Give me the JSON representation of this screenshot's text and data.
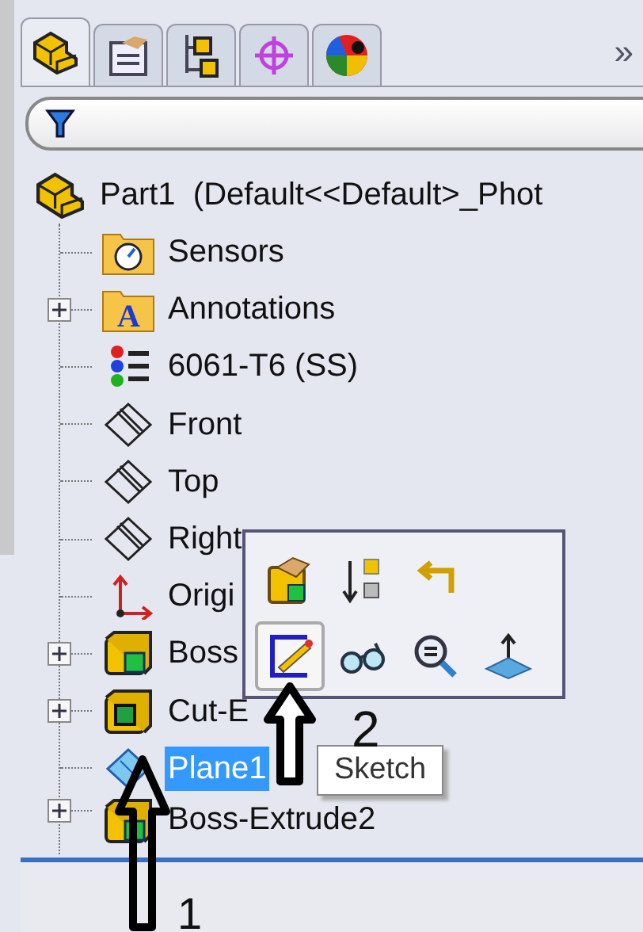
{
  "tabs": [
    {
      "kind": "part",
      "selected": true
    },
    {
      "kind": "property",
      "selected": false
    },
    {
      "kind": "config",
      "selected": false
    },
    {
      "kind": "target",
      "selected": false
    },
    {
      "kind": "appearance",
      "selected": false
    }
  ],
  "tabs_more": "»",
  "tree": {
    "label": "Part1  (Default<<Default>_Phot",
    "kind": "part",
    "selected": false,
    "children": [
      {
        "label": "Sensors",
        "kind": "sensor-folder",
        "expandable": false,
        "selected": false
      },
      {
        "label": "Annotations",
        "kind": "annotation-folder",
        "icon_letter": "A",
        "expandable": true,
        "selected": false
      },
      {
        "label": "6061-T6 (SS)",
        "kind": "material",
        "expandable": false,
        "selected": false
      },
      {
        "label": "Front",
        "kind": "plane",
        "expandable": false,
        "selected": false
      },
      {
        "label": "Top",
        "kind": "plane",
        "expandable": false,
        "selected": false
      },
      {
        "label": "Right",
        "kind": "plane",
        "expandable": false,
        "selected": false
      },
      {
        "label": "Origi",
        "kind": "origin",
        "expandable": false,
        "selected": false
      },
      {
        "label": "Boss",
        "kind": "boss",
        "expandable": true,
        "selected": false
      },
      {
        "label": "Cut-E",
        "kind": "cut",
        "expandable": true,
        "selected": false
      },
      {
        "label": "Plane1",
        "kind": "plane-selected",
        "expandable": false,
        "selected": true
      },
      {
        "label": "Boss-Extrude2",
        "kind": "boss",
        "expandable": true,
        "selected": false
      }
    ]
  },
  "context_toolbar": {
    "buttons": [
      {
        "kind": "edit-feature",
        "selected": false
      },
      {
        "kind": "rollback",
        "selected": false
      },
      {
        "kind": "undo",
        "selected": false
      },
      {
        "kind": "sketch",
        "selected": true
      },
      {
        "kind": "glasses",
        "selected": false
      },
      {
        "kind": "zoom",
        "selected": false
      },
      {
        "kind": "normal",
        "selected": false
      }
    ]
  },
  "tooltip": "Sketch",
  "annotations": [
    {
      "kind": "arrow-2",
      "label": "2"
    },
    {
      "kind": "arrow-1",
      "label": "1"
    }
  ]
}
